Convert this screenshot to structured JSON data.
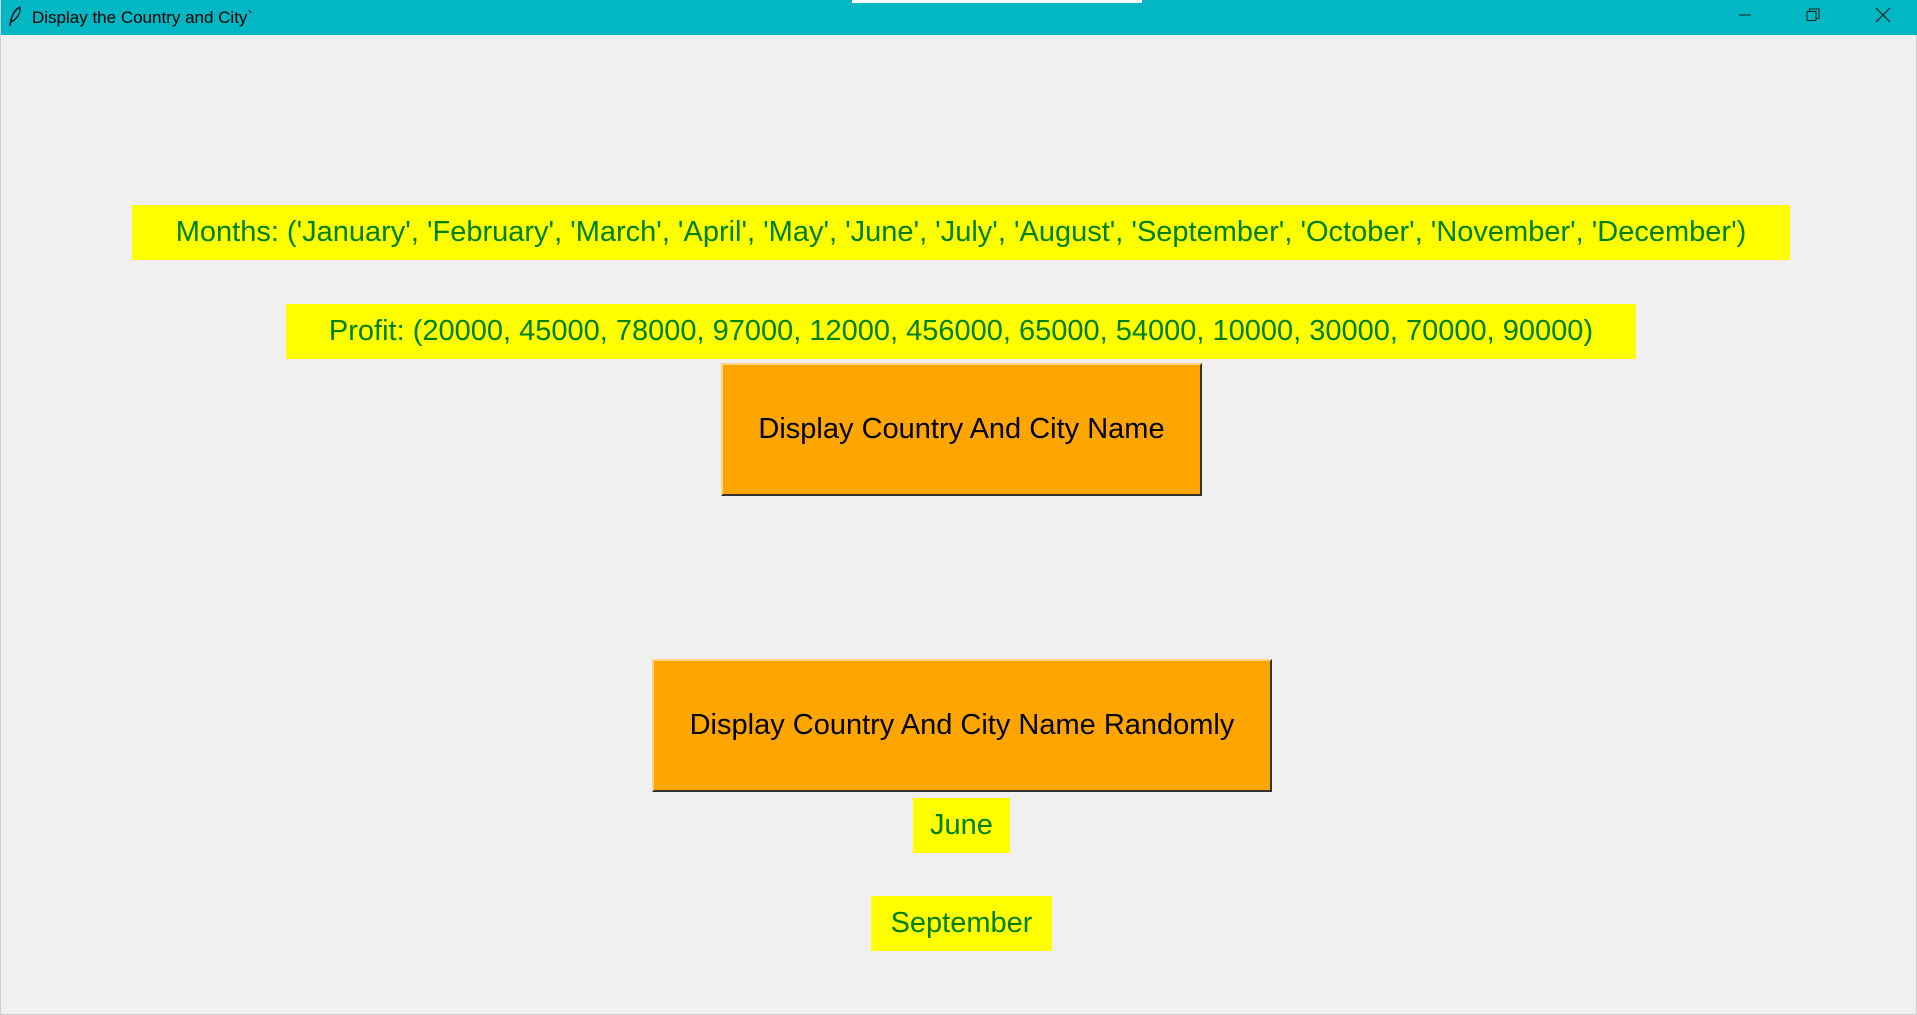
{
  "window": {
    "title": "Display the Country and City`",
    "controls": {
      "minimize_icon": "minimize-icon",
      "maximize_icon": "restore-icon",
      "close_icon": "close-icon"
    },
    "titlebar_color": "#00b7c3"
  },
  "labels": {
    "months": "Months: ('January', 'February', 'March', 'April', 'May', 'June', 'July', 'August', 'September', 'October', 'November', 'December')",
    "profit": "Profit: (20000, 45000, 78000, 97000, 12000, 456000, 65000, 54000, 10000, 30000, 70000, 90000)"
  },
  "buttons": {
    "display": "Display Country And City Name",
    "random": "Display Country And City Name Randomly"
  },
  "results": [
    "June",
    "September"
  ],
  "colors": {
    "label_bg": "#ffff00",
    "label_text": "#008000",
    "button_bg": "#ffa500",
    "window_bg": "#f0f0f0"
  }
}
